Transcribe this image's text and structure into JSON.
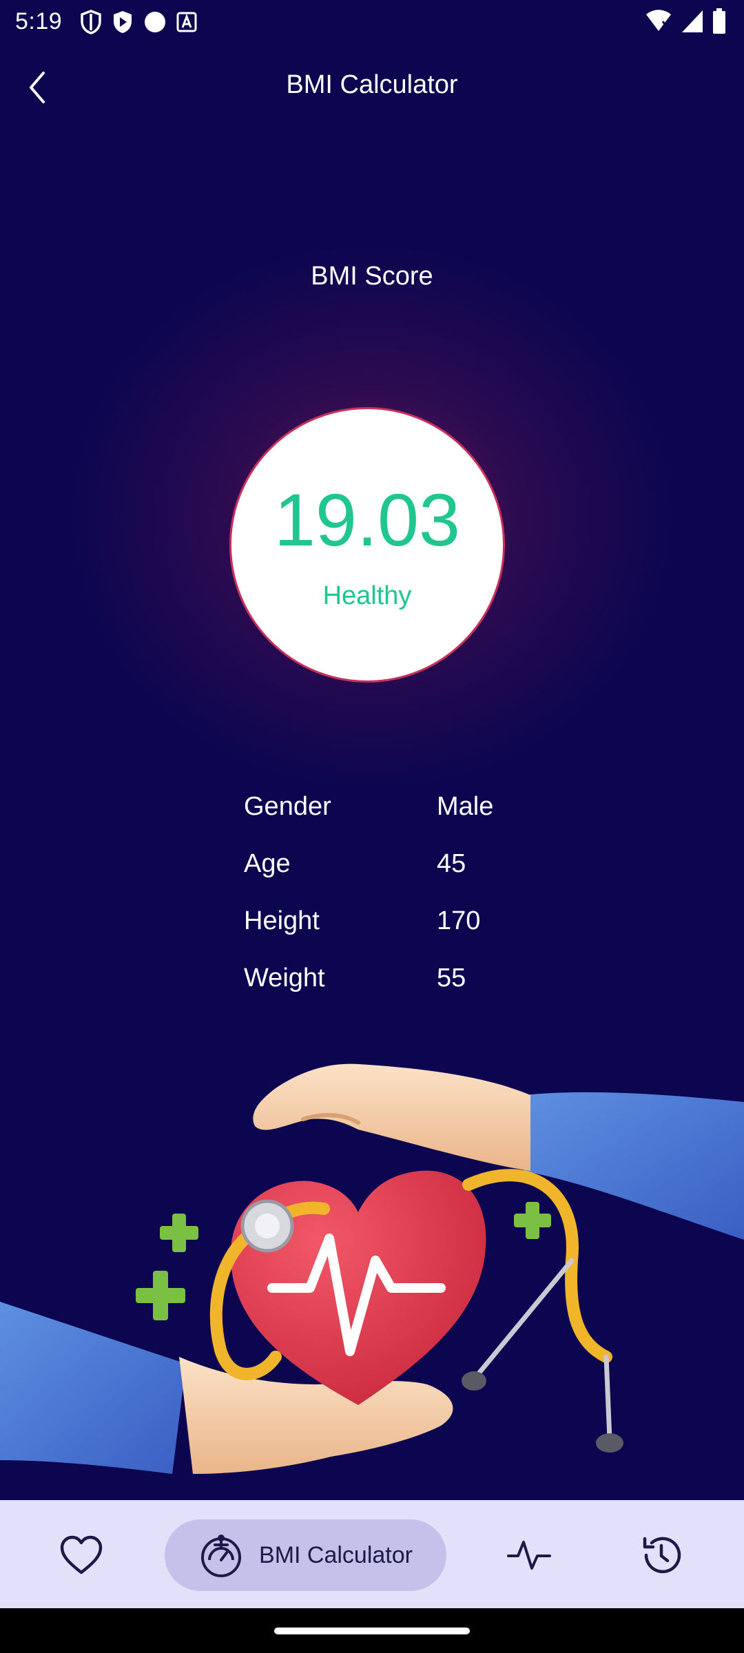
{
  "status_bar": {
    "time": "5:19",
    "left_icons": [
      "shield-icon",
      "play-store-icon",
      "circle-icon",
      "a-box-icon"
    ],
    "right_icons": [
      "wifi-icon",
      "signal-icon",
      "battery-icon"
    ]
  },
  "app_bar": {
    "title": "BMI Calculator",
    "back_icon": "chevron-left-icon"
  },
  "result": {
    "label": "BMI Score",
    "value": "19.03",
    "status": "Healthy",
    "status_color": "#20c58f"
  },
  "details": [
    {
      "label": "Gender",
      "value": "Male"
    },
    {
      "label": "Age",
      "value": "45"
    },
    {
      "label": "Height",
      "value": "170"
    },
    {
      "label": "Weight",
      "value": "55"
    }
  ],
  "bottom_nav": {
    "items": [
      {
        "icon": "heart-icon",
        "label": ""
      },
      {
        "icon": "bmi-scale-icon",
        "label": "BMI Calculator",
        "active": true
      },
      {
        "icon": "pulse-icon",
        "label": ""
      },
      {
        "icon": "history-icon",
        "label": ""
      }
    ]
  },
  "colors": {
    "background": "#0c0650",
    "accent": "#20c58f",
    "nav_background": "#e3e1fa",
    "nav_active": "#c5c1ea"
  }
}
